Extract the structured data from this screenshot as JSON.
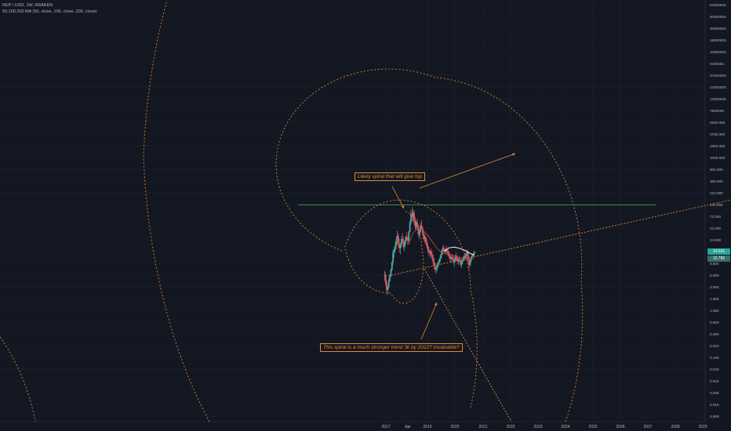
{
  "header": {
    "symbol_line": "REP / USD, 1W, KRAKEN",
    "indicator_line": "50,100,200 MA (50, close, 100, close, 200, close)"
  },
  "colors": {
    "background": "#131722",
    "grid": "#1f2433",
    "axis_text": "#b2b5be",
    "spiral": "#d9832a",
    "trendline": "#e08a2a",
    "horizontal_level": "#3a8a4a",
    "up_candle": "#4fa59a",
    "down_candle": "#e0585f",
    "ma_red": "#d6434a",
    "ma_white": "#e8e8e8",
    "price_box_current": "#26a69a",
    "price_box_ma": "#3a6a6a"
  },
  "chart_data": {
    "type": "line",
    "instrument": "REP / USD",
    "timeframe": "1W",
    "exchange": "KRAKEN",
    "scale": "log",
    "x_axis_labels": [
      "2017",
      "Apr",
      "2019",
      "2020",
      "2021",
      "2022",
      "2023",
      "2024",
      "2025",
      "2026",
      "2027",
      "2028",
      "2029"
    ],
    "y_axis_labels": [
      "63000000.",
      "50000000.",
      "30000000.",
      "18000000.",
      "10000000.",
      "6100000.",
      "37000000.",
      "22000000.",
      "13000000.",
      "7800000.",
      "4550.000",
      "2750.000",
      "1650.000",
      "1000.000",
      "600.000",
      "360.000",
      "210.000",
      "120.000",
      "72.000",
      "42.000",
      "24.000",
      "14.000",
      "8.500",
      "5.000",
      "3.000",
      "1.800",
      "1.050",
      "0.600",
      "0.360",
      "0.210",
      "0.130",
      "0.078",
      "0.042",
      "0.025",
      "0.015",
      "0.009"
    ],
    "current_price_label": "14.591",
    "ma_price_label": "10.786",
    "horizontal_level": 120,
    "annotations": [
      {
        "text": "Likely spiral that will give top"
      },
      {
        "text": "This spiral is a much stronger trend 3k by 2022? Invaluable?"
      }
    ],
    "price_series": [
      {
        "t": 2016.95,
        "o": 5.0,
        "h": 6.2,
        "l": 4.0,
        "c": 5.2
      },
      {
        "t": 2016.99,
        "o": 5.2,
        "h": 5.8,
        "l": 3.2,
        "c": 3.6
      },
      {
        "t": 2017.03,
        "o": 3.6,
        "h": 4.0,
        "l": 2.2,
        "c": 2.6
      },
      {
        "t": 2017.07,
        "o": 2.6,
        "h": 3.2,
        "l": 2.1,
        "c": 3.0
      },
      {
        "t": 2017.11,
        "o": 3.0,
        "h": 4.4,
        "l": 2.8,
        "c": 4.0
      },
      {
        "t": 2017.15,
        "o": 4.0,
        "h": 5.4,
        "l": 3.7,
        "c": 5.0
      },
      {
        "t": 2017.19,
        "o": 5.0,
        "h": 7.0,
        "l": 4.6,
        "c": 6.5
      },
      {
        "t": 2017.23,
        "o": 6.5,
        "h": 9.5,
        "l": 6.0,
        "c": 9.0
      },
      {
        "t": 2017.27,
        "o": 9.0,
        "h": 16.0,
        "l": 8.0,
        "c": 14.0
      },
      {
        "t": 2017.31,
        "o": 14.0,
        "h": 18.0,
        "l": 11.0,
        "c": 16.0
      },
      {
        "t": 2017.35,
        "o": 16.0,
        "h": 22.0,
        "l": 14.0,
        "c": 19.0
      },
      {
        "t": 2017.39,
        "o": 19.0,
        "h": 28.0,
        "l": 16.0,
        "c": 24.0
      },
      {
        "t": 2017.43,
        "o": 24.0,
        "h": 38.0,
        "l": 20.0,
        "c": 30.0
      },
      {
        "t": 2017.47,
        "o": 30.0,
        "h": 34.0,
        "l": 18.0,
        "c": 21.0
      },
      {
        "t": 2017.51,
        "o": 21.0,
        "h": 26.0,
        "l": 14.0,
        "c": 17.0
      },
      {
        "t": 2017.55,
        "o": 17.0,
        "h": 22.0,
        "l": 13.0,
        "c": 20.0
      },
      {
        "t": 2017.59,
        "o": 20.0,
        "h": 30.0,
        "l": 18.0,
        "c": 26.0
      },
      {
        "t": 2017.63,
        "o": 26.0,
        "h": 34.0,
        "l": 22.0,
        "c": 24.0
      },
      {
        "t": 2017.67,
        "o": 24.0,
        "h": 28.0,
        "l": 16.0,
        "c": 18.0
      },
      {
        "t": 2017.71,
        "o": 18.0,
        "h": 24.0,
        "l": 15.0,
        "c": 22.0
      },
      {
        "t": 2017.75,
        "o": 22.0,
        "h": 30.0,
        "l": 20.0,
        "c": 28.0
      },
      {
        "t": 2017.79,
        "o": 28.0,
        "h": 36.0,
        "l": 24.0,
        "c": 26.0
      },
      {
        "t": 2017.83,
        "o": 26.0,
        "h": 30.0,
        "l": 20.0,
        "c": 24.0
      },
      {
        "t": 2017.87,
        "o": 24.0,
        "h": 38.0,
        "l": 22.0,
        "c": 36.0
      },
      {
        "t": 2017.91,
        "o": 36.0,
        "h": 60.0,
        "l": 34.0,
        "c": 55.0
      },
      {
        "t": 2017.95,
        "o": 55.0,
        "h": 95.0,
        "l": 50.0,
        "c": 80.0
      },
      {
        "t": 2017.99,
        "o": 80.0,
        "h": 110.0,
        "l": 60.0,
        "c": 70.0
      },
      {
        "t": 2018.03,
        "o": 70.0,
        "h": 100.0,
        "l": 55.0,
        "c": 85.0
      },
      {
        "t": 2018.07,
        "o": 85.0,
        "h": 95.0,
        "l": 50.0,
        "c": 58.0
      },
      {
        "t": 2018.11,
        "o": 58.0,
        "h": 70.0,
        "l": 40.0,
        "c": 45.0
      },
      {
        "t": 2018.15,
        "o": 45.0,
        "h": 60.0,
        "l": 38.0,
        "c": 55.0
      },
      {
        "t": 2018.19,
        "o": 55.0,
        "h": 65.0,
        "l": 40.0,
        "c": 44.0
      },
      {
        "t": 2018.23,
        "o": 44.0,
        "h": 50.0,
        "l": 28.0,
        "c": 32.0
      },
      {
        "t": 2018.27,
        "o": 32.0,
        "h": 40.0,
        "l": 26.0,
        "c": 36.0
      },
      {
        "t": 2018.31,
        "o": 36.0,
        "h": 55.0,
        "l": 34.0,
        "c": 48.0
      },
      {
        "t": 2018.35,
        "o": 48.0,
        "h": 62.0,
        "l": 40.0,
        "c": 42.0
      },
      {
        "t": 2018.39,
        "o": 42.0,
        "h": 46.0,
        "l": 30.0,
        "c": 33.0
      },
      {
        "t": 2018.43,
        "o": 33.0,
        "h": 38.0,
        "l": 24.0,
        "c": 26.0
      },
      {
        "t": 2018.47,
        "o": 26.0,
        "h": 32.0,
        "l": 22.0,
        "c": 28.0
      },
      {
        "t": 2018.51,
        "o": 28.0,
        "h": 30.0,
        "l": 20.0,
        "c": 22.0
      },
      {
        "t": 2018.55,
        "o": 22.0,
        "h": 26.0,
        "l": 17.0,
        "c": 19.0
      },
      {
        "t": 2018.59,
        "o": 19.0,
        "h": 22.0,
        "l": 14.0,
        "c": 16.0
      },
      {
        "t": 2018.63,
        "o": 16.0,
        "h": 18.0,
        "l": 12.0,
        "c": 14.0
      },
      {
        "t": 2018.67,
        "o": 14.0,
        "h": 16.0,
        "l": 11.0,
        "c": 15.0
      },
      {
        "t": 2018.71,
        "o": 15.0,
        "h": 17.0,
        "l": 12.0,
        "c": 13.0
      },
      {
        "t": 2018.75,
        "o": 13.0,
        "h": 15.0,
        "l": 10.0,
        "c": 11.0
      },
      {
        "t": 2018.79,
        "o": 11.0,
        "h": 13.0,
        "l": 8.0,
        "c": 9.0
      },
      {
        "t": 2018.83,
        "o": 9.0,
        "h": 11.0,
        "l": 6.5,
        "c": 7.5
      },
      {
        "t": 2018.87,
        "o": 7.5,
        "h": 9.0,
        "l": 5.8,
        "c": 6.5
      },
      {
        "t": 2018.91,
        "o": 6.5,
        "h": 8.0,
        "l": 5.5,
        "c": 7.0
      },
      {
        "t": 2018.95,
        "o": 7.0,
        "h": 9.0,
        "l": 6.2,
        "c": 8.5
      },
      {
        "t": 2018.99,
        "o": 8.5,
        "h": 10.0,
        "l": 7.5,
        "c": 9.0
      },
      {
        "t": 2019.03,
        "o": 9.0,
        "h": 11.0,
        "l": 8.0,
        "c": 10.5
      },
      {
        "t": 2019.07,
        "o": 10.5,
        "h": 13.0,
        "l": 9.5,
        "c": 12.5
      },
      {
        "t": 2019.11,
        "o": 12.5,
        "h": 16.0,
        "l": 11.0,
        "c": 15.0
      },
      {
        "t": 2019.15,
        "o": 15.0,
        "h": 19.0,
        "l": 13.0,
        "c": 17.0
      },
      {
        "t": 2019.19,
        "o": 17.0,
        "h": 20.0,
        "l": 15.0,
        "c": 16.0
      },
      {
        "t": 2019.23,
        "o": 16.0,
        "h": 18.0,
        "l": 13.0,
        "c": 14.5
      },
      {
        "t": 2019.27,
        "o": 14.5,
        "h": 17.0,
        "l": 13.5,
        "c": 16.0
      },
      {
        "t": 2019.31,
        "o": 16.0,
        "h": 19.0,
        "l": 14.0,
        "c": 15.0
      },
      {
        "t": 2019.35,
        "o": 15.0,
        "h": 16.5,
        "l": 12.0,
        "c": 13.0
      },
      {
        "t": 2019.39,
        "o": 13.0,
        "h": 15.0,
        "l": 11.0,
        "c": 12.0
      },
      {
        "t": 2019.43,
        "o": 12.0,
        "h": 14.0,
        "l": 9.5,
        "c": 10.5
      },
      {
        "t": 2019.47,
        "o": 10.5,
        "h": 12.5,
        "l": 8.8,
        "c": 11.5
      },
      {
        "t": 2019.51,
        "o": 11.5,
        "h": 13.5,
        "l": 10.0,
        "c": 10.8
      },
      {
        "t": 2019.55,
        "o": 10.8,
        "h": 12.0,
        "l": 8.5,
        "c": 9.2
      },
      {
        "t": 2019.59,
        "o": 9.2,
        "h": 11.0,
        "l": 7.5,
        "c": 10.0
      },
      {
        "t": 2019.63,
        "o": 10.0,
        "h": 13.0,
        "l": 9.0,
        "c": 12.0
      },
      {
        "t": 2019.67,
        "o": 12.0,
        "h": 14.0,
        "l": 10.0,
        "c": 11.0
      },
      {
        "t": 2019.71,
        "o": 11.0,
        "h": 12.5,
        "l": 8.5,
        "c": 9.5
      },
      {
        "t": 2019.75,
        "o": 9.5,
        "h": 11.0,
        "l": 8.0,
        "c": 10.5
      },
      {
        "t": 2019.79,
        "o": 10.5,
        "h": 12.0,
        "l": 9.0,
        "c": 9.8
      },
      {
        "t": 2019.83,
        "o": 9.8,
        "h": 11.0,
        "l": 7.5,
        "c": 8.2
      },
      {
        "t": 2019.87,
        "o": 8.2,
        "h": 10.0,
        "l": 7.0,
        "c": 9.5
      },
      {
        "t": 2019.91,
        "o": 9.5,
        "h": 11.5,
        "l": 8.5,
        "c": 10.5
      },
      {
        "t": 2019.95,
        "o": 10.5,
        "h": 12.5,
        "l": 9.5,
        "c": 11.8
      },
      {
        "t": 2019.99,
        "o": 11.8,
        "h": 13.5,
        "l": 10.0,
        "c": 11.0
      },
      {
        "t": 2020.03,
        "o": 11.0,
        "h": 14.0,
        "l": 10.5,
        "c": 13.0
      },
      {
        "t": 2020.07,
        "o": 13.0,
        "h": 16.0,
        "l": 12.0,
        "c": 14.5
      },
      {
        "t": 2020.11,
        "o": 14.5,
        "h": 15.5,
        "l": 9.0,
        "c": 10.0
      },
      {
        "t": 2020.15,
        "o": 10.0,
        "h": 12.0,
        "l": 6.5,
        "c": 8.0
      },
      {
        "t": 2020.19,
        "o": 8.0,
        "h": 10.5,
        "l": 7.5,
        "c": 9.8
      },
      {
        "t": 2020.23,
        "o": 9.8,
        "h": 12.0,
        "l": 9.0,
        "c": 11.5
      },
      {
        "t": 2020.27,
        "o": 11.5,
        "h": 13.5,
        "l": 10.5,
        "c": 12.5
      },
      {
        "t": 2020.31,
        "o": 12.5,
        "h": 14.0,
        "l": 11.5,
        "c": 13.2
      },
      {
        "t": 2020.35,
        "o": 13.2,
        "h": 15.5,
        "l": 12.5,
        "c": 14.591
      }
    ],
    "moving_averages": [
      {
        "name": "MA 50",
        "color": "ma_red",
        "points": [
          [
            2017.85,
            20.0
          ],
          [
            2018.0,
            32.0
          ],
          [
            2018.15,
            40.0
          ],
          [
            2018.3,
            40.0
          ],
          [
            2018.45,
            36.0
          ],
          [
            2018.6,
            30.0
          ],
          [
            2018.75,
            23.0
          ],
          [
            2018.9,
            18.0
          ],
          [
            2019.05,
            15.0
          ],
          [
            2019.2,
            13.5
          ],
          [
            2019.4,
            13.0
          ],
          [
            2019.6,
            12.0
          ],
          [
            2019.8,
            11.2
          ],
          [
            2020.0,
            10.8
          ],
          [
            2020.2,
            10.6
          ],
          [
            2020.35,
            10.786
          ]
        ]
      },
      {
        "name": "MA 100",
        "color": "ma_white",
        "points": [
          [
            2019.2,
            15.0
          ],
          [
            2019.4,
            17.5
          ],
          [
            2019.6,
            18.0
          ],
          [
            2019.8,
            17.0
          ],
          [
            2020.0,
            15.5
          ],
          [
            2020.2,
            13.5
          ],
          [
            2020.35,
            12.5
          ]
        ]
      }
    ]
  }
}
